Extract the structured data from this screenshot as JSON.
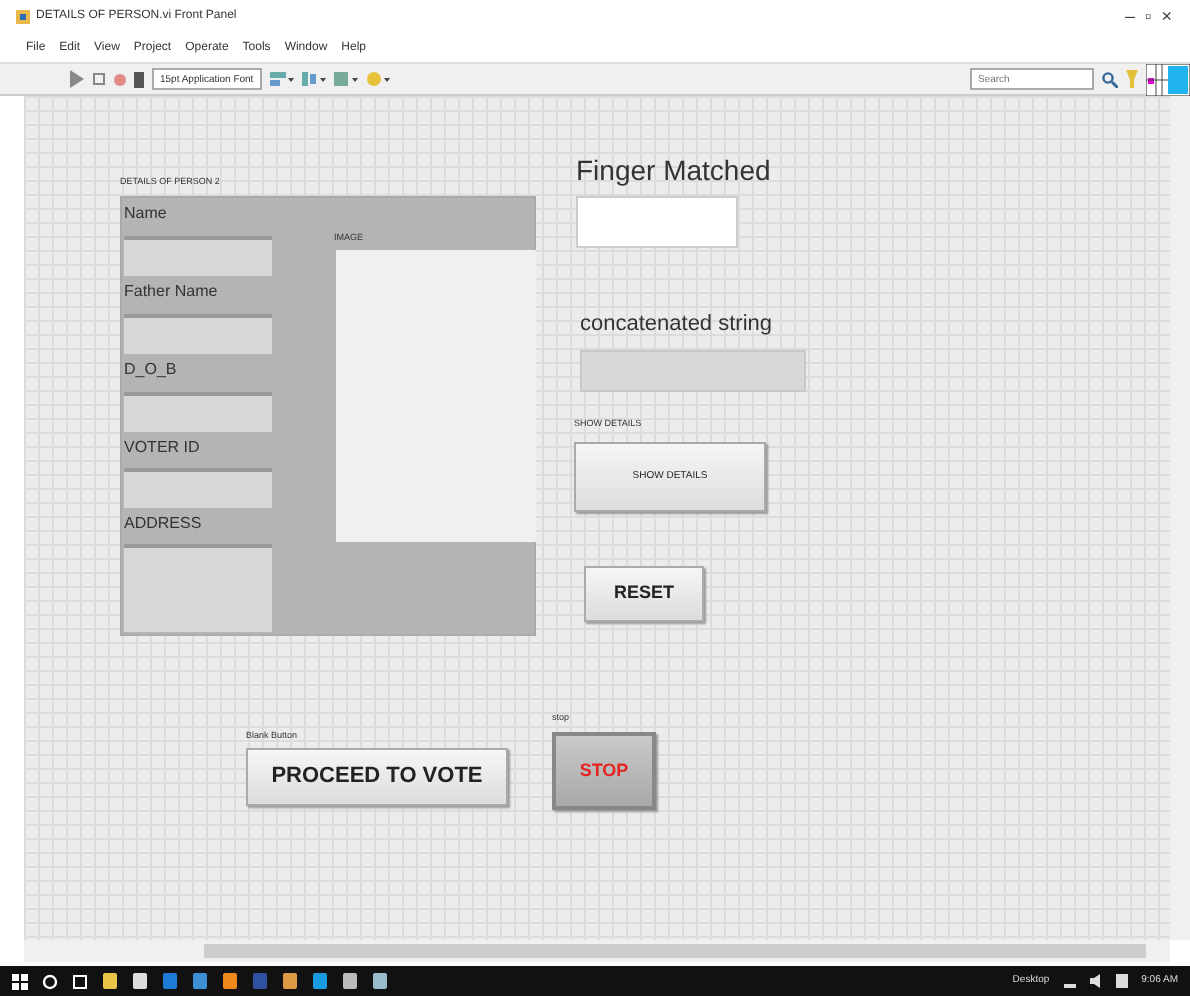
{
  "window": {
    "title": "DETAILS OF PERSON.vi Front Panel",
    "controls": [
      "–",
      "▫",
      "×"
    ]
  },
  "menu": [
    "File",
    "Edit",
    "View",
    "Project",
    "Operate",
    "Tools",
    "Window",
    "Help"
  ],
  "toolbar": {
    "font": "15pt Application Font",
    "search": {
      "placeholder": "Search"
    }
  },
  "panel": {
    "cluster": {
      "label": "DETAILS OF PERSON 2",
      "fields": [
        {
          "label": "Name"
        },
        {
          "label": "Father  Name"
        },
        {
          "label": "D_O_B"
        },
        {
          "label": "VOTER ID"
        },
        {
          "label": "ADDRESS"
        }
      ],
      "image_label": "IMAGE"
    },
    "finger_matched": {
      "label": "Finger Matched"
    },
    "concatenated": {
      "label": "concatenated string"
    },
    "buttons": [
      {
        "kind": "large",
        "label": "SHOW DETAILS",
        "text": "SHOW DETAILS"
      },
      {
        "kind": "bold",
        "text": "RESET"
      },
      {
        "kind": "bold",
        "label": "Blank Button",
        "text": "PROCEED TO VOTE"
      },
      {
        "kind": "stop",
        "label": "stop",
        "text": "STOP"
      }
    ]
  },
  "taskbar": {
    "tray_label": "Desktop",
    "time": "9:06 AM"
  }
}
